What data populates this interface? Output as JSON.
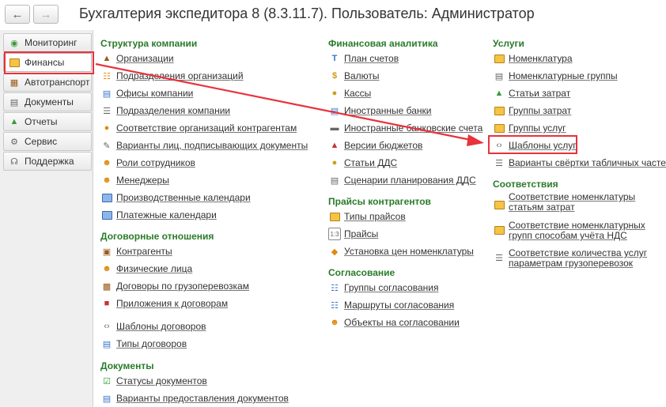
{
  "window": {
    "title": "Бухгалтерия экспедитора 8 (8.3.11.7). Пользователь: Администратор",
    "back_icon": "arrow-left-icon",
    "forward_icon": "arrow-right-icon"
  },
  "sidebar": {
    "items": [
      {
        "label": "Мониторинг",
        "icon": "globe-icon"
      },
      {
        "label": "Финансы",
        "icon": "finance-icon",
        "active": true
      },
      {
        "label": "Автотранспорт",
        "icon": "truck-icon"
      },
      {
        "label": "Документы",
        "icon": "document-icon"
      },
      {
        "label": "Отчеты",
        "icon": "report-chart-icon"
      },
      {
        "label": "Сервис",
        "icon": "gear-icon"
      },
      {
        "label": "Поддержка",
        "icon": "headset-icon"
      }
    ]
  },
  "col1": {
    "sections": [
      {
        "title": "Структура компании",
        "items": [
          "Организации",
          "Подразделения организаций",
          "Офисы компании",
          "Подразделения компании",
          "Соответствие организаций контрагентам",
          "Варианты лиц, подписывающих документы",
          "Роли сотрудников",
          "Менеджеры",
          "Производственные календари",
          "Платежные календари"
        ]
      },
      {
        "title": "Договорные отношения",
        "items": [
          "Контрагенты",
          "Физические лица",
          "Договоры по грузоперевозкам",
          "Приложения к договорам",
          "Шаблоны договоров",
          "Типы договоров"
        ]
      },
      {
        "title": "Документы",
        "items": [
          "Статусы документов",
          "Варианты предоставления документов"
        ]
      }
    ]
  },
  "col2": {
    "sections": [
      {
        "title": "Финансовая аналитика",
        "items": [
          "План счетов",
          "Валюты",
          "Кассы",
          "Иностранные банки",
          "Иностранные банковские счета",
          "Версии бюджетов",
          "Статьи ДДС",
          "Сценарии планирования ДДС"
        ]
      },
      {
        "title": "Прайсы контрагентов",
        "items": [
          "Типы прайсов",
          "Прайсы",
          "Установка цен номенклатуры"
        ]
      },
      {
        "title": "Согласование",
        "items": [
          "Группы согласования",
          "Маршруты согласования",
          "Объекты на согласовании"
        ]
      }
    ]
  },
  "col3": {
    "sections": [
      {
        "title": "Услуги",
        "items": [
          "Номенклатура",
          "Номенклатурные группы",
          "Статьи затрат",
          "Группы затрат",
          "Группы услуг",
          "Шаблоны услуг",
          "Варианты свёртки табличных частей"
        ]
      },
      {
        "title": "Соответствия",
        "items": [
          "Соответствие номенклатуры статьям затрат",
          "Соответствие номенклатурных групп способам учёта НДС",
          "Соответствие количества услуг параметрам грузоперевозок"
        ]
      }
    ]
  },
  "colors": {
    "section_title": "#2a7b2a",
    "highlight": "#e8323c"
  }
}
